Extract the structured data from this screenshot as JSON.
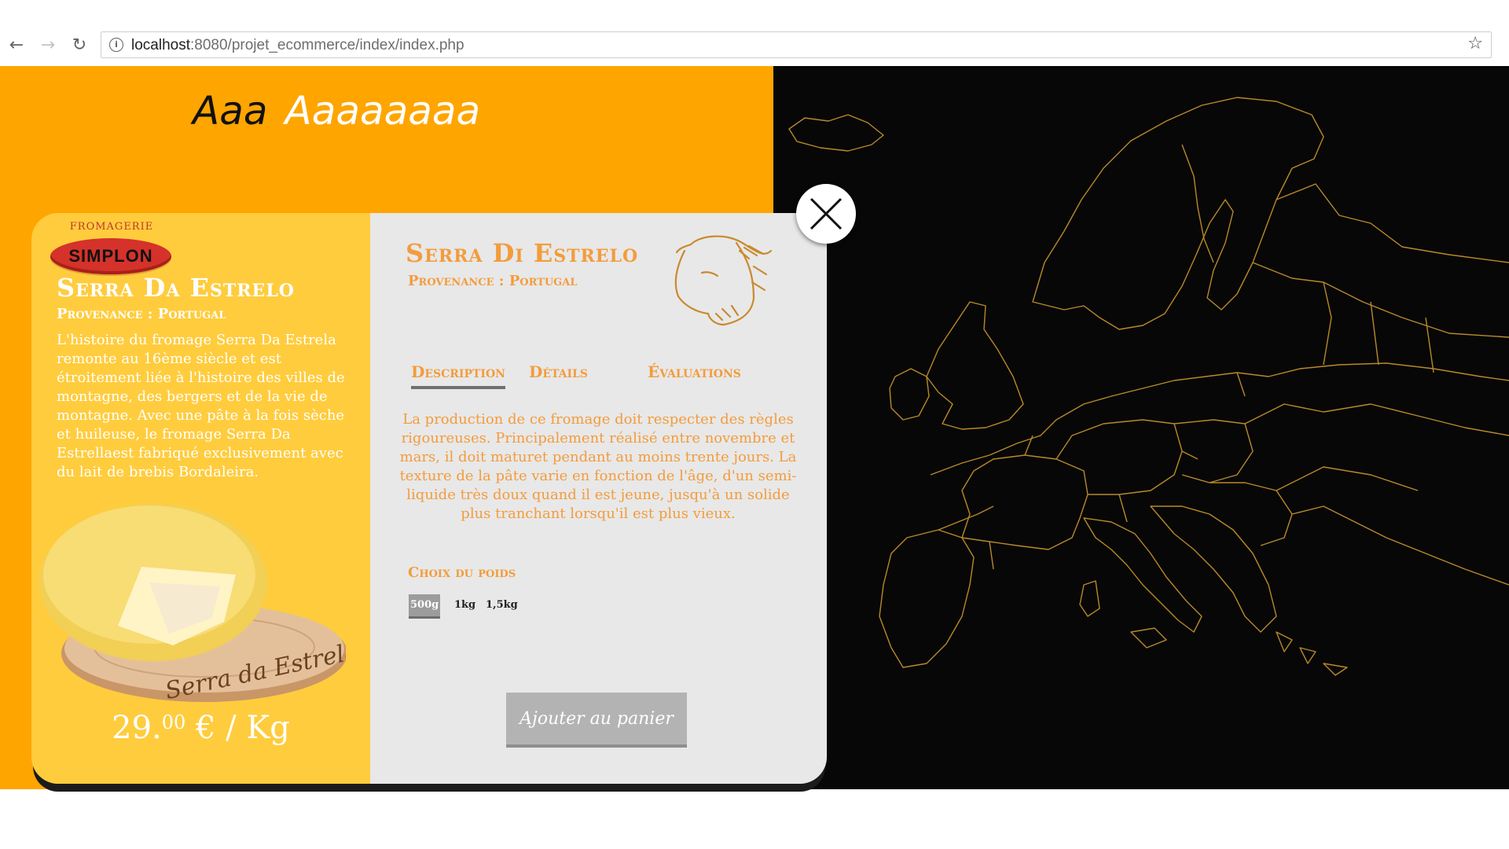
{
  "browser": {
    "url_host": "localhost",
    "url_rest": ":8080/projet_ecommerce/index/index.php",
    "back_icon": "arrow-left-icon",
    "forward_icon": "arrow-right-icon",
    "reload_icon": "reload-icon",
    "bookmark_icon": "star-icon"
  },
  "site": {
    "title_word1": "Aaa",
    "title_word2": "Aaaaaaaa"
  },
  "product": {
    "brand_arc": "FROMAGERIE",
    "brand_name": "SIMPLON",
    "name_left": "Serra Da Estrelo",
    "provenance_left": "Provenance : Portugal",
    "story": "L'histoire du fromage Serra Da Estrela remonte au 16ème siècle et est étroitement liée à l'histoire des villes de montagne, des bergers et de la vie de montagne. Avec une pâte à la fois sèche et huileuse, le fromage Serra Da Estrellaest fabriqué exclusivement avec du lait de brebis Bordaleira.",
    "image_label": "Serra da Estrela",
    "price_main": "29.",
    "price_cents": "00",
    "price_unit": " € / Kg",
    "name_right": "Serra Di Estrelo",
    "provenance_right": "Provenance : Portugal",
    "tabs": [
      "Description",
      "Détails",
      "Évaluations"
    ],
    "description": "La production de ce fromage doit respecter des règles rigoureuses. Principalement  réalisé entre novembre et mars, il doit maturet pendant au moins trente jours. La texture de la pâte varie en fonction de l'âge, d'un semi-liquide très doux quand il est jeune, jusqu'à un solide plus tranchant lorsqu'il est plus vieux.",
    "weight_title": "Choix du poids",
    "weights": [
      "500g",
      "1kg",
      "1,5kg"
    ],
    "selected_weight": "500g",
    "cart_button": "Ajouter au panier"
  },
  "colors": {
    "orange_bg": "#ffa500",
    "card_left": "#ffcc3d",
    "card_right": "#e8e8e8",
    "accent_text": "#f39c3c",
    "map_bg": "#070707",
    "map_lines": "#b8892a"
  }
}
